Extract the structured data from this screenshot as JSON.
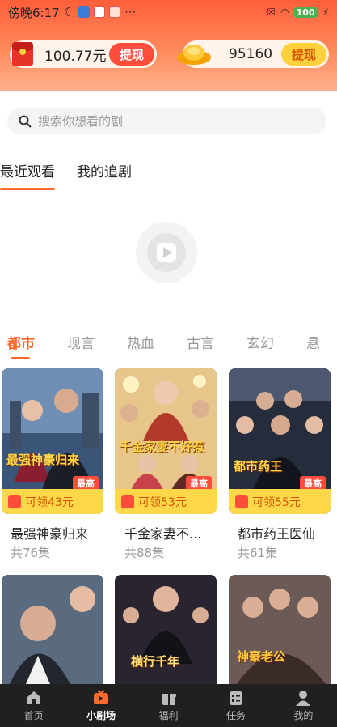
{
  "status_bar": {
    "time": "傍晚6:17",
    "battery": "100"
  },
  "wallet": {
    "cash": {
      "value": "100.77元",
      "button": "提现"
    },
    "coins": {
      "value": "95160",
      "button": "提现"
    }
  },
  "search": {
    "placeholder": "搜索你想看的剧"
  },
  "history_tabs": [
    {
      "label": "最近观看",
      "active": true
    },
    {
      "label": "我的追剧",
      "active": false
    }
  ],
  "categories": [
    {
      "label": "都市",
      "active": true
    },
    {
      "label": "现言",
      "active": false
    },
    {
      "label": "热血",
      "active": false
    },
    {
      "label": "古言",
      "active": false
    },
    {
      "label": "玄幻",
      "active": false
    },
    {
      "label": "悬",
      "active": false
    }
  ],
  "dramas": [
    {
      "title": "最强神豪归来",
      "episodes": "共76集",
      "reward": "可领43元",
      "badge": "最高",
      "poster_text": "最强神豪归来"
    },
    {
      "title": "千金家妻不...",
      "episodes": "共88集",
      "reward": "可领53元",
      "badge": "最高",
      "poster_text": "千金家妻不好惹"
    },
    {
      "title": "都市药王医仙",
      "episodes": "共61集",
      "reward": "可领55元",
      "badge": "最高",
      "poster_text": "都市药王"
    },
    {
      "poster_text": ""
    },
    {
      "poster_text": "横行千年"
    },
    {
      "poster_text": "神豪老公"
    }
  ],
  "bottom_nav": [
    {
      "label": "首页",
      "icon": "home-icon",
      "active": false
    },
    {
      "label": "小剧场",
      "icon": "theater-icon",
      "active": true
    },
    {
      "label": "福利",
      "icon": "gift-icon",
      "active": false
    },
    {
      "label": "任务",
      "icon": "tasks-icon",
      "active": false
    },
    {
      "label": "我的",
      "icon": "profile-icon",
      "active": false
    }
  ],
  "colors": {
    "accent": "#ff6a2b",
    "header_top": "#ff5e3a",
    "reward_bg": "#ffd84a",
    "nav_bg": "#202020"
  }
}
